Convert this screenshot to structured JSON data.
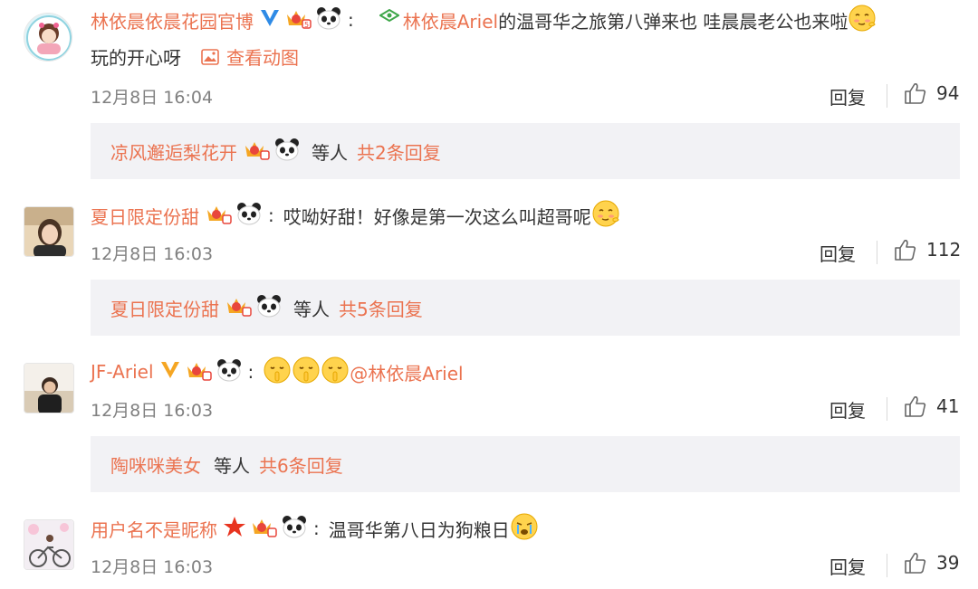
{
  "comments": [
    {
      "username": "林依晨依晨花园官博",
      "mention": "林依晨Ariel",
      "text": " 的温哥华之旅第八弹来也 哇晨晨老公也来啦",
      "text2": "玩的开心呀",
      "view_gif": "查看动图",
      "time": "12月8日 16:04",
      "reply": "回复",
      "likes": "94",
      "sub_user": "凉风邂逅梨花开",
      "sub_etc": "等人",
      "sub_total": "共2条回复"
    },
    {
      "username": "夏日限定份甜",
      "text": "哎呦好甜！好像是第一次这么叫超哥呢",
      "time": "12月8日 16:03",
      "reply": "回复",
      "likes": "112",
      "sub_user": "夏日限定份甜",
      "sub_etc": "等人",
      "sub_total": "共5条回复"
    },
    {
      "username": "JF-Ariel",
      "text": "@林依晨Ariel",
      "time": "12月8日 16:03",
      "reply": "回复",
      "likes": "41",
      "sub_user": "陶咪咪美女",
      "sub_etc": "等人",
      "sub_total": "共6条回复"
    },
    {
      "username": "用户名不是昵称",
      "text": "温哥华第八日为狗粮日",
      "time": "12月8日 16:03",
      "reply": "回复",
      "likes": "39"
    }
  ],
  "colors": {
    "link": "#eb7350",
    "text": "#333333",
    "meta": "#808080",
    "subbox_bg": "#f2f2f5",
    "verified_blue": "#2f8be6",
    "verified_gold": "#f5a623"
  }
}
